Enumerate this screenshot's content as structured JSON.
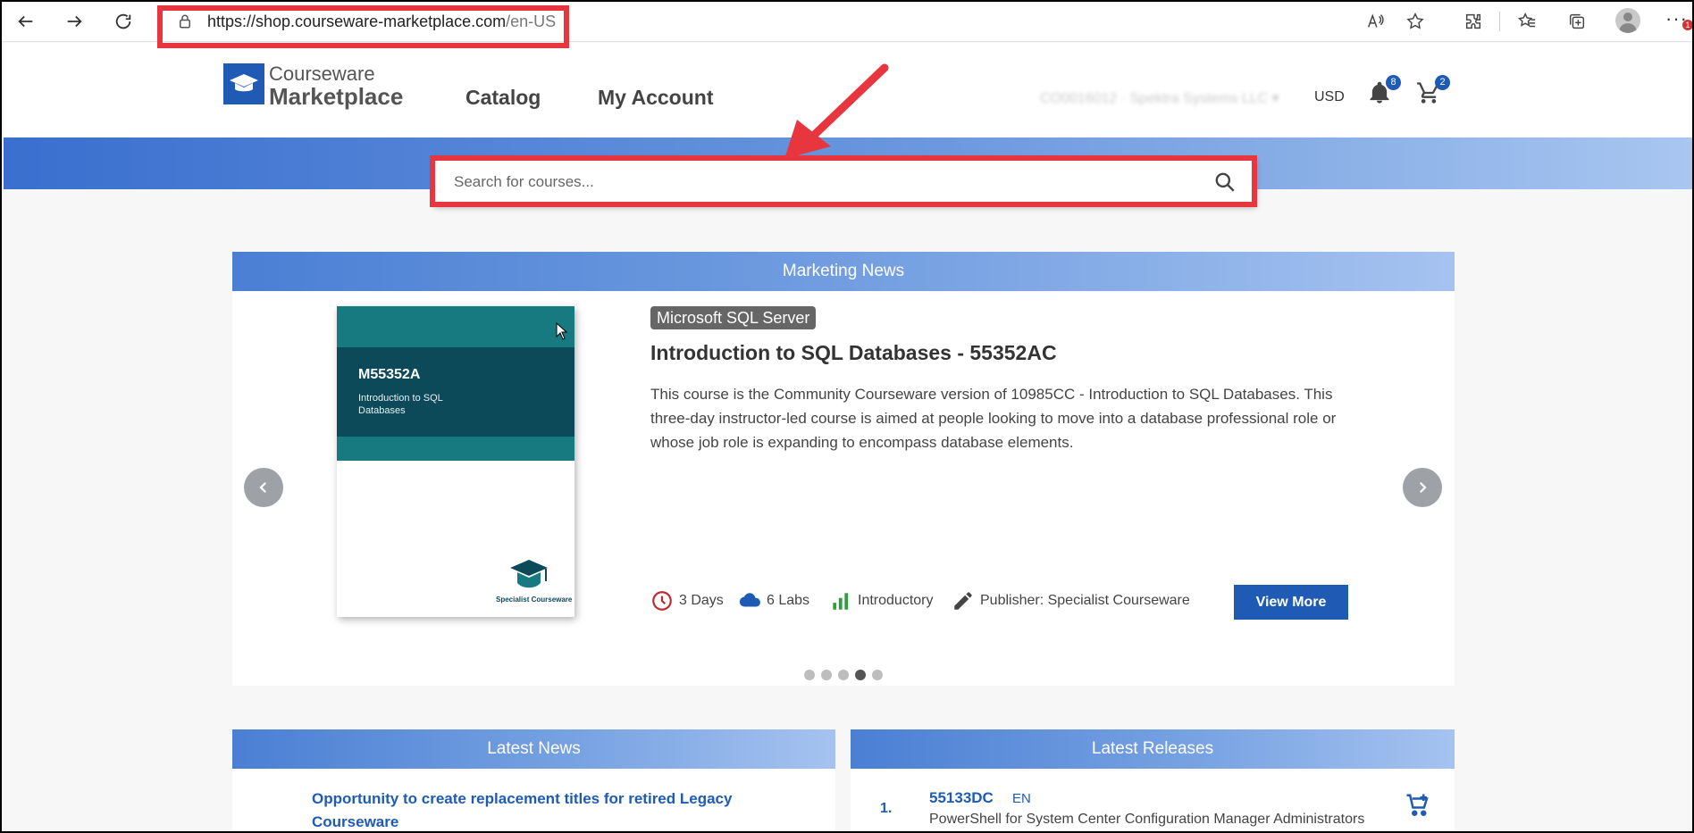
{
  "browser": {
    "url_host": "https://shop.courseware-marketplace.com",
    "url_path": "/en-US",
    "notification_count": "1"
  },
  "site": {
    "logo_top": "Courseware",
    "logo_bottom": "Marketplace",
    "nav": [
      "Catalog",
      "My Account"
    ],
    "account_blurred": "CO0016012 · Spektra Systems LLC ▾",
    "currency": "USD",
    "notifications_count": "8",
    "cart_count": "2"
  },
  "search": {
    "placeholder": "Search for courses..."
  },
  "marketing": {
    "header": "Marketing News",
    "cover_code": "M55352A",
    "cover_title": "Introduction to SQL Databases",
    "cover_publisher": "Specialist Courseware",
    "tag": "Microsoft SQL Server",
    "title": "Introduction to SQL Databases - 55352AC",
    "description": "This course is the Community Courseware version of 10985CC - Introduction to SQL Databases. This three-day instructor-led course is aimed at people looking to move into a database professional role or whose job role is expanding to encompass database elements.",
    "duration": "3 Days",
    "labs": "6 Labs",
    "level": "Introductory",
    "publisher": "Publisher: Specialist Courseware",
    "view_more": "View More",
    "slide_count": 5,
    "active_slide": 4
  },
  "latest_news": {
    "header": "Latest News",
    "items": [
      "Opportunity to create replacement titles for retired Legacy Courseware"
    ]
  },
  "latest_releases": {
    "header": "Latest Releases",
    "items": [
      {
        "num": "1.",
        "code": "55133DC",
        "lang": "EN",
        "title": "PowerShell for System Center Configuration Manager Administrators"
      }
    ]
  },
  "colors": {
    "brand_blue": "#1f5bb5",
    "annotation_red": "#e8363f",
    "teal": "#177a80"
  }
}
